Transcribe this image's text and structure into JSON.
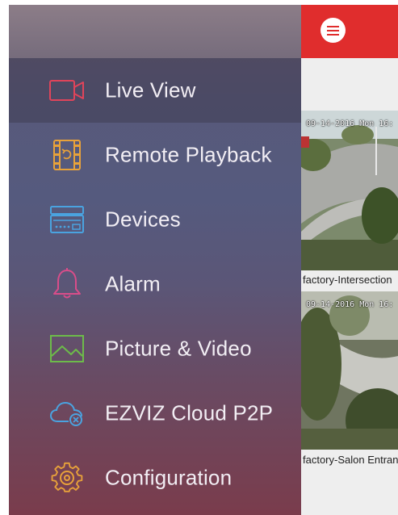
{
  "app": {
    "accent_color": "#e02d2d"
  },
  "drawer": {
    "items": [
      {
        "label": "Live View",
        "icon": "video-camera-icon",
        "color": "#e0445a",
        "active": true
      },
      {
        "label": "Remote Playback",
        "icon": "playback-film-icon",
        "color": "#e8a23a",
        "active": false
      },
      {
        "label": "Devices",
        "icon": "dvr-device-icon",
        "color": "#4aa3e0",
        "active": false
      },
      {
        "label": "Alarm",
        "icon": "bell-icon",
        "color": "#d94d8a",
        "active": false
      },
      {
        "label": "Picture & Video",
        "icon": "picture-icon",
        "color": "#6dbb4a",
        "active": false
      },
      {
        "label": "EZVIZ Cloud P2P",
        "icon": "cloud-p2p-icon",
        "color": "#4aa3e0",
        "active": false
      },
      {
        "label": "Configuration",
        "icon": "gear-icon",
        "color": "#e8a23a",
        "active": false
      }
    ]
  },
  "header": {
    "menu_icon": "menu-icon"
  },
  "cameras": [
    {
      "timestamp": "09-14-2016 Mon 16:",
      "label": "factory-Intersection"
    },
    {
      "timestamp": "09-14-2016 Mon 16:",
      "label": "factory-Salon Entrance"
    }
  ]
}
